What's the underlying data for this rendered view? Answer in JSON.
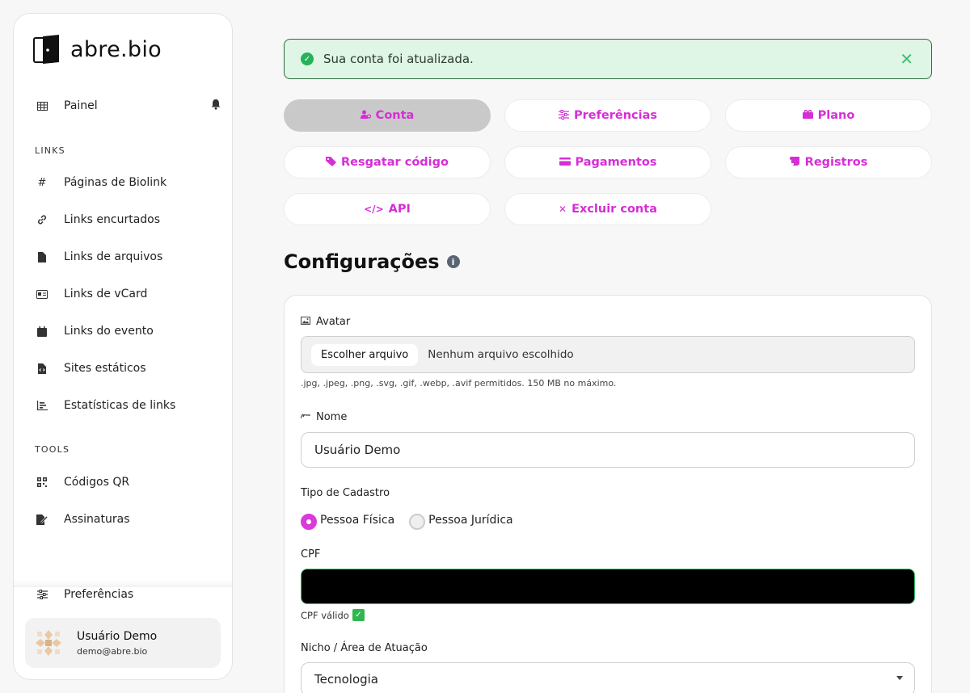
{
  "app": {
    "logo_text": "abre.bio"
  },
  "sidebar": {
    "dashboard_label": "Painel",
    "links_section": "LINKS",
    "links": [
      {
        "label": "Páginas de Biolink",
        "icon": "hash-icon"
      },
      {
        "label": "Links encurtados",
        "icon": "link-icon"
      },
      {
        "label": "Links de arquivos",
        "icon": "file-icon"
      },
      {
        "label": "Links de vCard",
        "icon": "id-card-icon"
      },
      {
        "label": "Links do evento",
        "icon": "calendar-icon"
      },
      {
        "label": "Sites estáticos",
        "icon": "file-code-icon"
      },
      {
        "label": "Estatísticas de links",
        "icon": "chart-icon"
      }
    ],
    "tools_section": "TOOLS",
    "tools": [
      {
        "label": "Códigos QR",
        "icon": "qrcode-icon"
      },
      {
        "label": "Assinaturas",
        "icon": "signature-icon"
      }
    ],
    "preferences_label": "Preferências",
    "user": {
      "name": "Usuário Demo",
      "email": "demo@abre.bio"
    }
  },
  "alert": {
    "message": "Sua conta foi atualizada.",
    "close": "✕"
  },
  "tabs": [
    {
      "label": "Conta",
      "icon": "user-cog-icon",
      "glyph": "👤"
    },
    {
      "label": "Preferências",
      "icon": "sliders-icon",
      "glyph": "⚙"
    },
    {
      "label": "Plano",
      "icon": "box-icon",
      "glyph": "▣"
    },
    {
      "label": "Resgatar código",
      "icon": "tags-icon",
      "glyph": "◆"
    },
    {
      "label": "Pagamentos",
      "icon": "credit-card-icon",
      "glyph": "▭"
    },
    {
      "label": "Registros",
      "icon": "scroll-icon",
      "glyph": "▤"
    },
    {
      "label": "API",
      "icon": "code-icon",
      "glyph": "</>"
    },
    {
      "label": "Excluir conta",
      "icon": "times-icon",
      "glyph": "✕"
    }
  ],
  "page": {
    "title": "Configurações",
    "info_glyph": "i"
  },
  "form": {
    "avatar_label": "Avatar",
    "file_button": "Escolher arquivo",
    "file_status": "Nenhum arquivo escolhido",
    "file_hint": ".jpg, .jpeg, .png, .svg, .gif, .webp, .avif permitidos. 150 MB no máximo.",
    "name_label": "Nome",
    "name_value": "Usuário Demo",
    "type_label": "Tipo de Cadastro",
    "type_options": [
      "Pessoa Física",
      "Pessoa Jurídica"
    ],
    "type_selected": "Pessoa Física",
    "cpf_label": "CPF",
    "cpf_valid": "CPF válido",
    "valid_mark": "✓",
    "niche_label": "Nicho / Área de Atuação",
    "niche_value": "Tecnologia"
  },
  "colors": {
    "accent": "#d62ed6",
    "success": "#24b25a",
    "alert_bg": "#dff5e6"
  }
}
